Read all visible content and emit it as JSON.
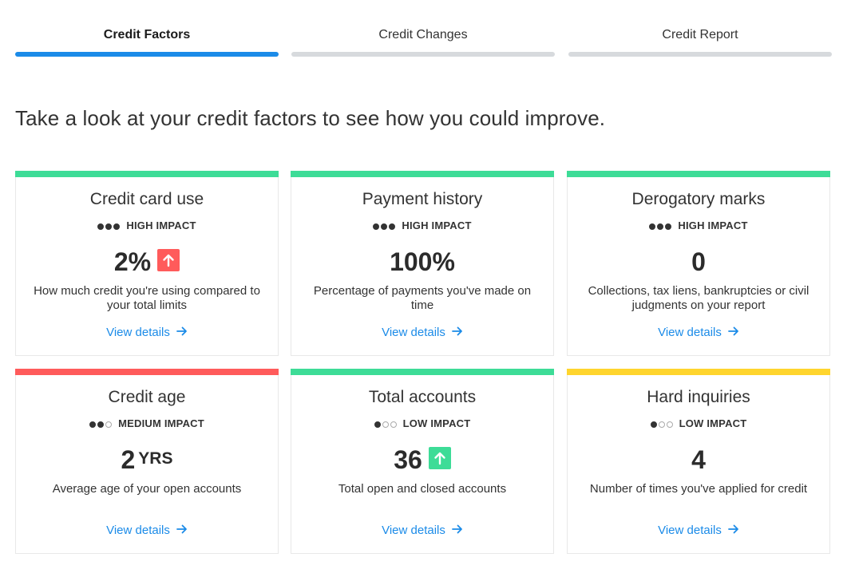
{
  "tabs": [
    {
      "label": "Credit Factors",
      "active": true
    },
    {
      "label": "Credit Changes",
      "active": false
    },
    {
      "label": "Credit Report",
      "active": false
    }
  ],
  "intro": "Take a look at your credit factors to see how you could improve.",
  "colors": {
    "green": "#3ddc97",
    "red": "#ff5b5b",
    "yellow": "#ffd52e",
    "link": "#1b8be8",
    "tab_active": "#1b8be8",
    "tab_inactive": "#d7dadd"
  },
  "cards": [
    {
      "title": "Credit card use",
      "impact_label": "HIGH IMPACT",
      "impact_level": 3,
      "value": "2%",
      "unit": "",
      "trend": "up-red",
      "description": "How much credit you're using compared to your total limits",
      "link": "View details",
      "accent": "green"
    },
    {
      "title": "Payment history",
      "impact_label": "HIGH IMPACT",
      "impact_level": 3,
      "value": "100%",
      "unit": "",
      "trend": "none",
      "description": "Percentage of payments you've made on time",
      "link": "View details",
      "accent": "green"
    },
    {
      "title": "Derogatory marks",
      "impact_label": "HIGH IMPACT",
      "impact_level": 3,
      "value": "0",
      "unit": "",
      "trend": "none",
      "description": "Collections, tax liens, bankruptcies or civil judgments on your report",
      "link": "View details",
      "accent": "green"
    },
    {
      "title": "Credit age",
      "impact_label": "MEDIUM IMPACT",
      "impact_level": 2,
      "value": "2",
      "unit": "YRS",
      "trend": "none",
      "description": "Average age of your open accounts",
      "link": "View details",
      "accent": "red"
    },
    {
      "title": "Total accounts",
      "impact_label": "LOW IMPACT",
      "impact_level": 1,
      "value": "36",
      "unit": "",
      "trend": "up-green",
      "description": "Total open and closed accounts",
      "link": "View details",
      "accent": "green"
    },
    {
      "title": "Hard inquiries",
      "impact_label": "LOW IMPACT",
      "impact_level": 1,
      "value": "4",
      "unit": "",
      "trend": "none",
      "description": "Number of times you've applied for credit",
      "link": "View details",
      "accent": "yellow"
    }
  ]
}
